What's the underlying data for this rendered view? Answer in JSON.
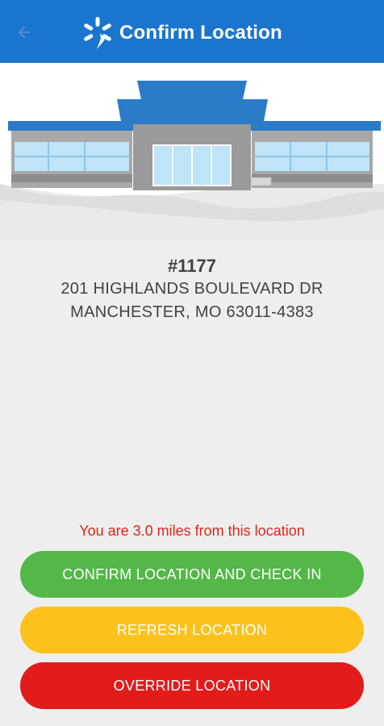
{
  "header": {
    "title": "Confirm Location",
    "back_icon": "arrow-left-icon",
    "brand_icon": "spark-logo-icon",
    "color": "#1a75cf"
  },
  "store": {
    "number": "#1177",
    "address_line1": "201 HIGHLANDS BOULEVARD DR",
    "address_line2": "MANCHESTER, MO 63011-4383"
  },
  "distance_text": "You are 3.0 miles from this location",
  "actions": {
    "confirm_label": "CONFIRM LOCATION AND CHECK IN",
    "refresh_label": "REFRESH LOCATION",
    "override_label": "OVERRIDE LOCATION"
  },
  "colors": {
    "confirm": "#53b848",
    "refresh": "#fcc21b",
    "override": "#e21b1b",
    "distance": "#e0251c"
  }
}
